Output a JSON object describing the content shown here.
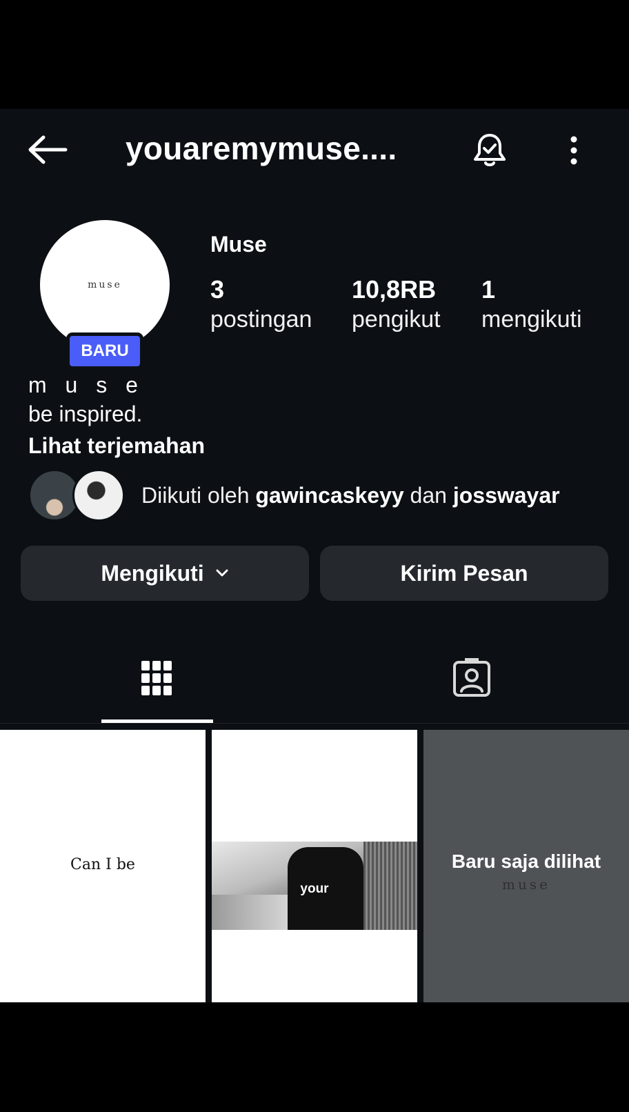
{
  "header": {
    "username": "youaremymuse....",
    "back_icon": "arrow-left-icon",
    "bell_icon": "notification-bell-check-icon",
    "more_icon": "vertical-ellipsis-icon"
  },
  "profile": {
    "avatar_text": "muse",
    "new_badge": "BARU",
    "display_name": "Muse",
    "stats": [
      {
        "value": "3",
        "label": "postingan"
      },
      {
        "value": "10,8RB",
        "label": "pengikut"
      },
      {
        "value": "1",
        "label": "mengikuti"
      }
    ],
    "bio_line1": "m u s e",
    "bio_line2": "be inspired.",
    "translate_link": "Lihat terjemahan",
    "followed_by": {
      "prefix": "Diikuti oleh ",
      "user1": "gawincaskeyy",
      "conjunction": " dan ",
      "user2": "josswayar"
    }
  },
  "actions": {
    "follow_label": "Mengikuti",
    "message_label": "Kirim Pesan"
  },
  "tabs": {
    "grid_icon": "grid-icon",
    "tagged_icon": "tagged-person-icon",
    "active": "grid"
  },
  "posts": [
    {
      "text": "Can I be"
    },
    {
      "text": "your"
    },
    {
      "label": "Baru saja dilihat",
      "sub": "muse"
    }
  ],
  "colors": {
    "background": "#0c1014",
    "button": "#25292e",
    "badge": "#4a5df9"
  }
}
